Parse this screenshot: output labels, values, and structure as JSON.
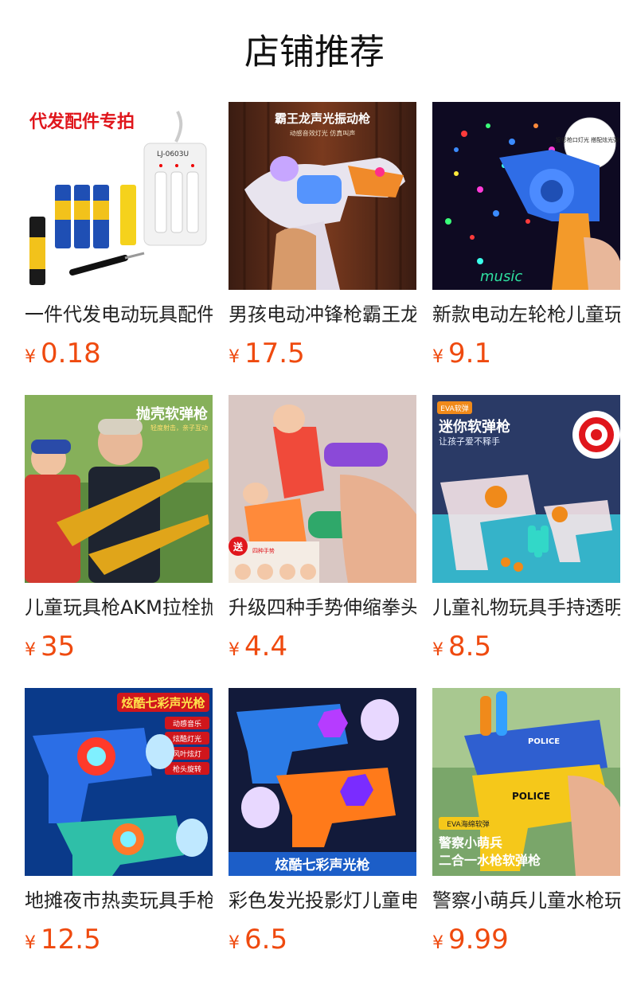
{
  "page": {
    "title": "店铺推荐"
  },
  "products": [
    {
      "name": "一件代发电动玩具配件",
      "currency": "¥",
      "price": "0.18",
      "badge": "代发配件专拍",
      "subtext": "LJ-0603U"
    },
    {
      "name": "男孩电动冲锋枪霸王龙",
      "currency": "¥",
      "price": "17.5",
      "badge": "霸王龙声光振动枪",
      "subtext": "动感音效灯光 仿真叫声"
    },
    {
      "name": "新款电动左轮枪儿童玩具",
      "currency": "¥",
      "price": "9.1",
      "badge": "投影枪口灯光 搭配炫光弹夹",
      "subtext": "music"
    },
    {
      "name": "儿童玩具枪AKM拉栓抛壳",
      "currency": "¥",
      "price": "35",
      "badge": "抛壳软弹枪",
      "subtext": "轻度射击，亲子互动"
    },
    {
      "name": "升级四种手势伸缩拳头",
      "currency": "¥",
      "price": "4.4",
      "badge": "送",
      "subtext": "四种手势"
    },
    {
      "name": "儿童礼物玩具手持透明",
      "currency": "¥",
      "price": "8.5",
      "badge": "迷你软弹枪",
      "subtext": "让孩子爱不释手",
      "tag": "EVA软弹"
    },
    {
      "name": "地摊夜市热卖玩具手枪",
      "currency": "¥",
      "price": "12.5",
      "badge": "炫酷七彩声光枪",
      "features": [
        "动感音乐",
        "炫酷灯光",
        "风叶炫灯",
        "枪头旋转"
      ]
    },
    {
      "name": "彩色发光投影灯儿童电动",
      "currency": "¥",
      "price": "6.5",
      "badge": "炫酷七彩声光枪"
    },
    {
      "name": "警察小萌兵儿童水枪玩具",
      "currency": "¥",
      "price": "9.99",
      "badge": "警察小萌兵",
      "subtext": "二合一水枪软弹枪",
      "tag": "EVA海绵软弹",
      "stamp": "POLICE"
    }
  ]
}
